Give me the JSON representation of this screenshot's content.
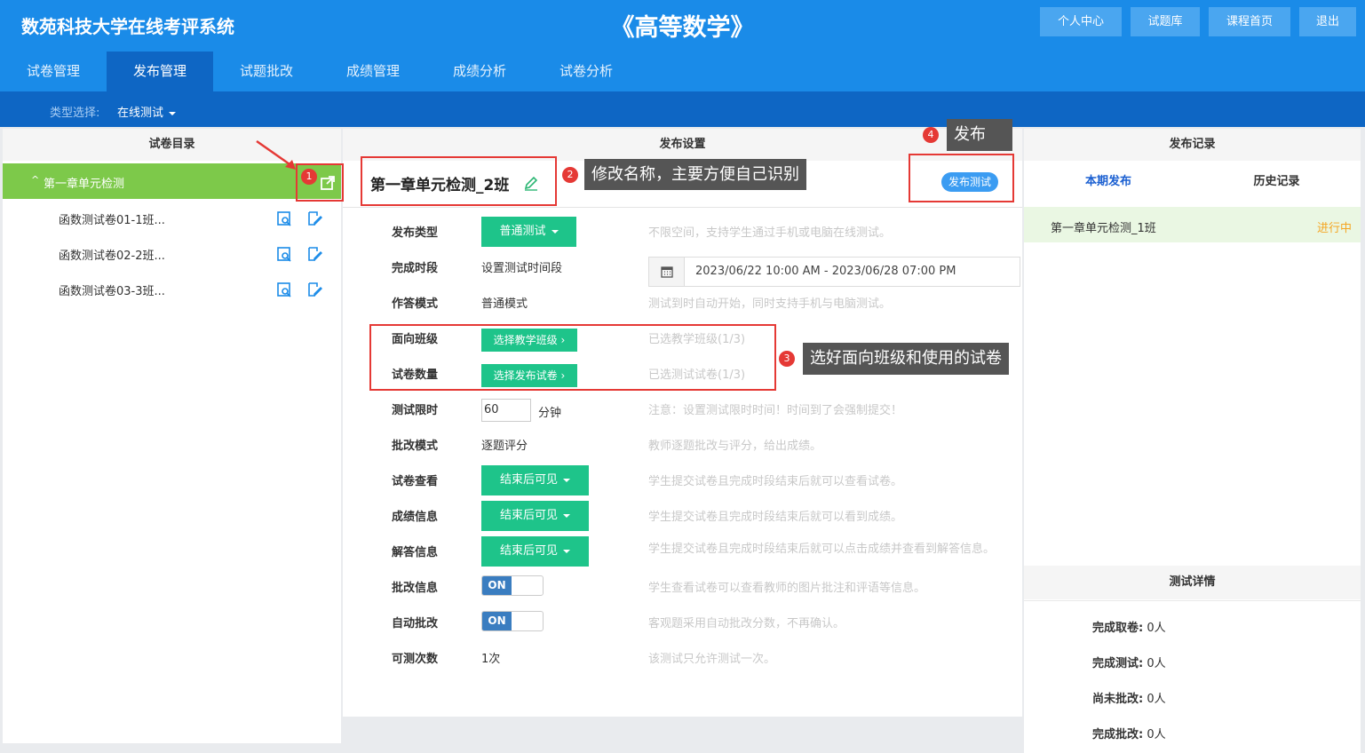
{
  "app": {
    "brand": "数苑科技大学在线考评系统",
    "course_title": "《高等数学》"
  },
  "top_buttons": [
    "个人中心",
    "试题库",
    "课程首页",
    "退出"
  ],
  "nav_tabs": [
    "试卷管理",
    "发布管理",
    "试题批改",
    "成绩管理",
    "成绩分析",
    "试卷分析"
  ],
  "type_select": {
    "label": "类型选择:",
    "value": "在线测试"
  },
  "left": {
    "header": "试卷目录",
    "root": "第一章单元检测",
    "items": [
      "函数测试卷01-1班...",
      "函数测试卷02-2班...",
      "函数测试卷03-3班..."
    ]
  },
  "middle": {
    "header": "发布设置",
    "title": "第一章单元检测_2班",
    "publish_button": "发布测试",
    "rows": {
      "type": {
        "label": "发布类型",
        "button": "普通测试",
        "hint": "不限空间，支持学生通过手机或电脑在线测试。"
      },
      "period": {
        "label": "完成时段",
        "value": "设置测试时间段",
        "range": "2023/06/22 10:00 AM - 2023/06/28 07:00 PM"
      },
      "mode": {
        "label": "作答模式",
        "value": "普通模式",
        "hint": "测试到时自动开始，同时支持手机与电脑测试。"
      },
      "class": {
        "label": "面向班级",
        "button": "选择教学班级",
        "hint": "已选教学班级(1/3)"
      },
      "papers": {
        "label": "试卷数量",
        "button": "选择发布试卷",
        "hint": "已选测试试卷(1/3)"
      },
      "limit": {
        "label": "测试限时",
        "value": "60",
        "unit": "分钟",
        "hint": "注意：设置测试限时时间！时间到了会强制提交！"
      },
      "grading": {
        "label": "批改模式",
        "value": "逐题评分",
        "hint": "教师逐题批改与评分，给出成绩。"
      },
      "view": {
        "label": "试卷查看",
        "button": "结束后可见",
        "hint": "学生提交试卷且完成时段结束后就可以查看试卷。"
      },
      "score": {
        "label": "成绩信息",
        "button": "结束后可见",
        "hint": "学生提交试卷且完成时段结束后就可以看到成绩。"
      },
      "answer": {
        "label": "解答信息",
        "button": "结束后可见",
        "hint": "学生提交试卷且完成时段结束后就可以点击成绩并查看到解答信息。"
      },
      "review": {
        "label": "批改信息",
        "toggle": "ON",
        "hint": "学生查看试卷可以查看教师的图片批注和评语等信息。"
      },
      "auto": {
        "label": "自动批改",
        "toggle": "ON",
        "hint": "客观题采用自动批改分数，不再确认。"
      },
      "attempts": {
        "label": "可测次数",
        "value": "1次",
        "hint": "该测试只允许测试一次。"
      }
    }
  },
  "right": {
    "header": "发布记录",
    "tabs": [
      "本期发布",
      "历史记录"
    ],
    "record": {
      "name": "第一章单元检测_1班",
      "status": "进行中"
    },
    "details_header": "测试详情",
    "details": [
      {
        "label": "完成取卷:",
        "value": "0人"
      },
      {
        "label": "完成测试:",
        "value": "0人"
      },
      {
        "label": "尚未批改:",
        "value": "0人"
      },
      {
        "label": "完成批改:",
        "value": "0人"
      }
    ]
  },
  "annotations": {
    "c2": "修改名称，主要方便自己识别",
    "c3": "选好面向班级和使用的试卷",
    "c4": "发布",
    "n1": "1",
    "n2": "2",
    "n3": "3",
    "n4": "4"
  },
  "colors": {
    "primary": "#1a8be8",
    "dark_blue": "#0e66c4",
    "green": "#1ec48a",
    "leaf_green": "#7dc94a",
    "annotation_red": "#e53935"
  }
}
